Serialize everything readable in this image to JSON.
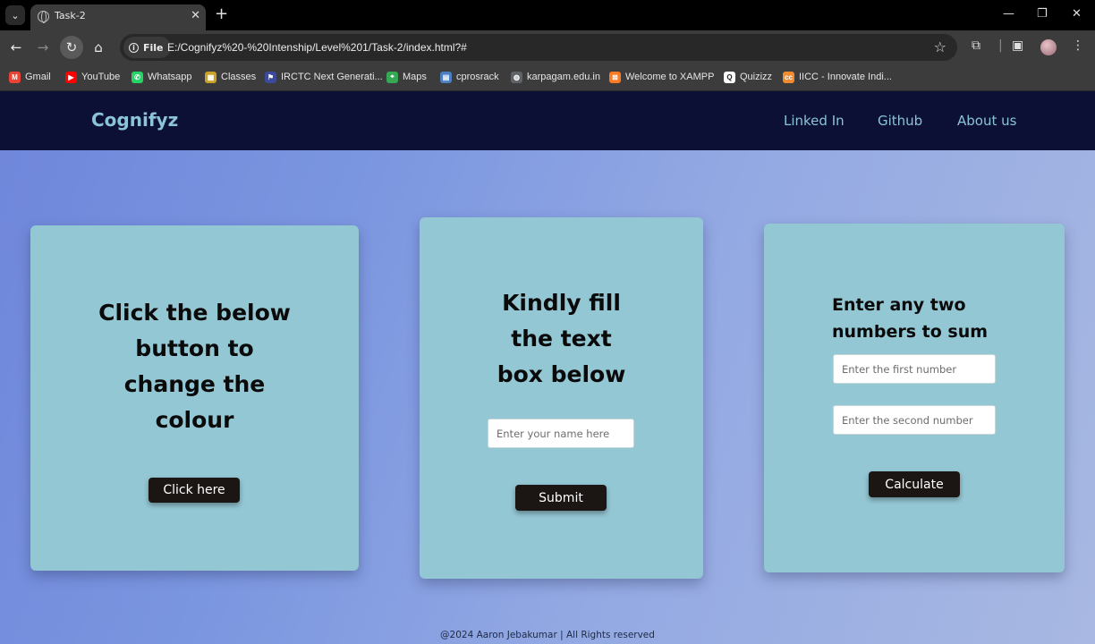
{
  "browser": {
    "tab_title": "Task-2",
    "tab_close": "✕",
    "new_tab": "+",
    "file_chip_label": "File",
    "url": "E:/Cognifyz%20-%20Intenship/Level%201/Task-2/index.html?#",
    "bookmarks": [
      {
        "label": "Gmail",
        "color": "#ea4335",
        "glyph": "M"
      },
      {
        "label": "YouTube",
        "color": "#ff0000",
        "glyph": "▶"
      },
      {
        "label": "Whatsapp",
        "color": "#25d366",
        "glyph": "✆"
      },
      {
        "label": "Classes",
        "color": "#c9a227",
        "glyph": "▦"
      },
      {
        "label": "IRCTC Next Generati...",
        "color": "#3b4a9a",
        "glyph": "⚑"
      },
      {
        "label": "Maps",
        "color": "#34a853",
        "glyph": "⌖"
      },
      {
        "label": "cprosrack",
        "color": "#4a7fc1",
        "glyph": "▤"
      },
      {
        "label": "karpagam.edu.in",
        "color": "#5f6368",
        "glyph": "◍"
      },
      {
        "label": "Welcome to XAMPP",
        "color": "#fb7a24",
        "glyph": "⊠"
      },
      {
        "label": "Quizizz",
        "color": "#ffffff",
        "glyph": "Q"
      },
      {
        "label": "IICC - Innovate Indi...",
        "color": "#f28b30",
        "glyph": "cc"
      }
    ]
  },
  "site": {
    "brand": "Cognifyz",
    "nav": [
      "Linked In",
      "Github",
      "About us"
    ],
    "card1": {
      "heading_lines": [
        "Click the below",
        "button to",
        "change the",
        "colour"
      ],
      "button_label": "Click here"
    },
    "card2": {
      "heading_lines": [
        "Kindly fill",
        "the text",
        "box below"
      ],
      "input_placeholder": "Enter your name here",
      "button_label": "Submit"
    },
    "card3": {
      "heading_lines": [
        "Enter any two",
        "numbers to sum"
      ],
      "first_placeholder": "Enter the first number",
      "second_placeholder": "Enter the second number",
      "button_label": "Calculate"
    },
    "footer": "@2024 Aaron Jebakumar | All Rights reserved"
  },
  "colors": {
    "header_bg": "#0c1035",
    "brand_text": "#8cc3d6",
    "card_bg": "#94c7d4",
    "button_bg": "#1b1613"
  }
}
